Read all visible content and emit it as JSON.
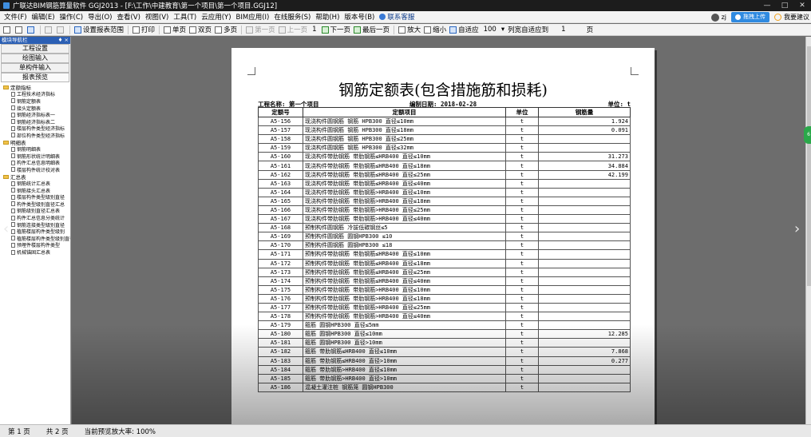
{
  "window": {
    "title": "广联达BIM钢筋算量软件 GGJ2013 - [F:\\工作\\中建教育\\第一个项目\\第一个项目.GGJ12]",
    "controls": [
      "—",
      "□",
      "✕"
    ]
  },
  "menu": {
    "items": [
      "文件(F)",
      "编辑(E)",
      "操作(C)",
      "导出(O)",
      "查看(V)",
      "视图(V)",
      "工具(T)",
      "云应用(Y)",
      "BIM应用(I)",
      "在线服务(S)",
      "帮助(H)",
      "版本号(B)"
    ],
    "customer_service": "联系客服",
    "user_short": "zj",
    "upload_label": "拖拽上传",
    "suggest_label": "我要建议"
  },
  "toolbar": {
    "set_range": "设置报表范围",
    "print": "打印",
    "single_page": "单页",
    "double_page": "双页",
    "multi_page": "多页",
    "first_page": "第一页",
    "prev_page": "上一页",
    "page_num": "1",
    "next_page": "下一页",
    "last_page": "最后一页",
    "zoom_in": "放大",
    "zoom_out": "缩小",
    "fit": "自适应",
    "zoom_value": "100",
    "col_fit": "列宽自适应到",
    "col_value": "1",
    "col_unit": "页"
  },
  "left_panel": {
    "header": "模块导航栏",
    "pin": "♦ ×",
    "nav_buttons": [
      "工程设置",
      "绘图输入",
      "单构件输入",
      "报表预览"
    ],
    "tree": [
      {
        "type": "folder",
        "label": "定额指标"
      },
      {
        "type": "leaf",
        "label": "工程技术经济指标"
      },
      {
        "type": "leaf",
        "label": "钢筋定额表"
      },
      {
        "type": "leaf",
        "label": "接头定额表"
      },
      {
        "type": "leaf",
        "label": "钢筋经济指标表一"
      },
      {
        "type": "leaf",
        "label": "钢筋经济指标表二"
      },
      {
        "type": "leaf",
        "label": "楼层构件类型经济指标"
      },
      {
        "type": "leaf",
        "label": "部位构件类型经济指标"
      },
      {
        "type": "folder",
        "label": "明细表"
      },
      {
        "type": "leaf",
        "label": "钢筋明细表"
      },
      {
        "type": "leaf",
        "label": "钢筋形状统计明细表"
      },
      {
        "type": "leaf",
        "label": "构件汇总信息明细表"
      },
      {
        "type": "leaf",
        "label": "楼层构件统计校对表"
      },
      {
        "type": "folder",
        "label": "汇总表"
      },
      {
        "type": "leaf",
        "label": "钢筋统计汇总表"
      },
      {
        "type": "leaf",
        "label": "钢筋接头汇总表"
      },
      {
        "type": "leaf",
        "label": "楼层构件类型级别直径"
      },
      {
        "type": "leaf",
        "label": "构件类型级别直径汇总"
      },
      {
        "type": "leaf",
        "label": "钢筋级别直径汇总表"
      },
      {
        "type": "leaf",
        "label": "构件汇总信息分类统计"
      },
      {
        "type": "leaf",
        "label": "钢筋连接类型级别直径"
      },
      {
        "type": "leaf",
        "label": "植筋楼层构件类型级别"
      },
      {
        "type": "leaf",
        "label": "植筋楼层构件类型级别直径"
      },
      {
        "type": "leaf",
        "label": "预埋件楼层构件类型"
      },
      {
        "type": "leaf",
        "label": "机械锚固汇总表"
      }
    ]
  },
  "report": {
    "title": "钢筋定额表(包含措施筋和损耗)",
    "project": "工程名称: 第一个项目",
    "date": "编制日期: 2018-02-28",
    "unit": "单位: t",
    "headers": [
      "定额号",
      "定额项目",
      "单位",
      "钢筋量"
    ],
    "rows": [
      [
        "A5-156",
        "现浇构件圆钢筋 钢筋 HPB300 直径≤10mm",
        "t",
        "1.924"
      ],
      [
        "A5-157",
        "现浇构件圆钢筋 钢筋 HPB300 直径≤18mm",
        "t",
        "0.091"
      ],
      [
        "A5-158",
        "现浇构件圆钢筋 钢筋 HPB300 直径≤25mm",
        "t",
        ""
      ],
      [
        "A5-159",
        "现浇构件圆钢筋 钢筋 HPB300 直径≤32mm",
        "t",
        ""
      ],
      [
        "A5-160",
        "现浇构件带肋钢筋 带肋钢筋≤HRB400 直径≤10mm",
        "t",
        "31.273"
      ],
      [
        "A5-161",
        "现浇构件带肋钢筋 带肋钢筋≤HRB400 直径≤18mm",
        "t",
        "34.884"
      ],
      [
        "A5-162",
        "现浇构件带肋钢筋 带肋钢筋≤HRB400 直径≤25mm",
        "t",
        "42.199"
      ],
      [
        "A5-163",
        "现浇构件带肋钢筋 带肋钢筋≤HRB400 直径≤40mm",
        "t",
        ""
      ],
      [
        "A5-164",
        "现浇构件带肋钢筋 带肋钢筋>HRB400 直径≤10mm",
        "t",
        ""
      ],
      [
        "A5-165",
        "现浇构件带肋钢筋 带肋钢筋>HRB400 直径≤18mm",
        "t",
        ""
      ],
      [
        "A5-166",
        "现浇构件带肋钢筋 带肋钢筋>HRB400 直径≤25mm",
        "t",
        ""
      ],
      [
        "A5-167",
        "现浇构件带肋钢筋 带肋钢筋>HRB400 直径≤40mm",
        "t",
        ""
      ],
      [
        "A5-168",
        "预制构件圆钢筋 冷拔低碳钢丝≤5",
        "t",
        ""
      ],
      [
        "A5-169",
        "预制构件圆钢筋 圆钢HPB300 ≤10",
        "t",
        ""
      ],
      [
        "A5-170",
        "预制构件圆钢筋 圆钢HPB300 ≤18",
        "t",
        ""
      ],
      [
        "A5-171",
        "预制构件带肋钢筋 带肋钢筋≤HRB400 直径≤10mm",
        "t",
        ""
      ],
      [
        "A5-172",
        "预制构件带肋钢筋 带肋钢筋≤HRB400 直径≤18mm",
        "t",
        ""
      ],
      [
        "A5-173",
        "预制构件带肋钢筋 带肋钢筋≤HRB400 直径≤25mm",
        "t",
        ""
      ],
      [
        "A5-174",
        "预制构件带肋钢筋 带肋钢筋≤HRB400 直径≤40mm",
        "t",
        ""
      ],
      [
        "A5-175",
        "预制构件带肋钢筋 带肋钢筋>HRB400 直径≤10mm",
        "t",
        ""
      ],
      [
        "A5-176",
        "预制构件带肋钢筋 带肋钢筋>HRB400 直径≤18mm",
        "t",
        ""
      ],
      [
        "A5-177",
        "预制构件带肋钢筋 带肋钢筋>HRB400 直径≤25mm",
        "t",
        ""
      ],
      [
        "A5-178",
        "预制构件带肋钢筋 带肋钢筋>HRB400 直径≤40mm",
        "t",
        ""
      ],
      [
        "A5-179",
        "箍筋 圆钢HPB300 直径≤5mm",
        "t",
        ""
      ],
      [
        "A5-180",
        "箍筋 圆钢HPB300 直径≤10mm",
        "t",
        "12.285"
      ],
      [
        "A5-181",
        "箍筋 圆钢HPB300 直径>10mm",
        "t",
        ""
      ],
      [
        "A5-182",
        "箍筋 带肋钢筋≤HRB400 直径≤10mm",
        "t",
        "7.868"
      ],
      [
        "A5-183",
        "箍筋 带肋钢筋≤HRB400 直径>10mm",
        "t",
        "0.277"
      ],
      [
        "A5-184",
        "箍筋 带肋钢筋>HRB400 直径≤10mm",
        "t",
        ""
      ],
      [
        "A5-185",
        "箍筋 带肋钢筋>HRB400 直径>10mm",
        "t",
        ""
      ],
      [
        "A5-186",
        "混凝土灌注桩 钢筋笼 圆钢HPB300",
        "t",
        ""
      ]
    ]
  },
  "status": {
    "page": "第 1 页",
    "total": "共 2 页",
    "zoom": "当前预览放大率: 100%"
  },
  "side": {
    "left_arrow": "‹",
    "right_arrow": "›",
    "badge": "6"
  }
}
